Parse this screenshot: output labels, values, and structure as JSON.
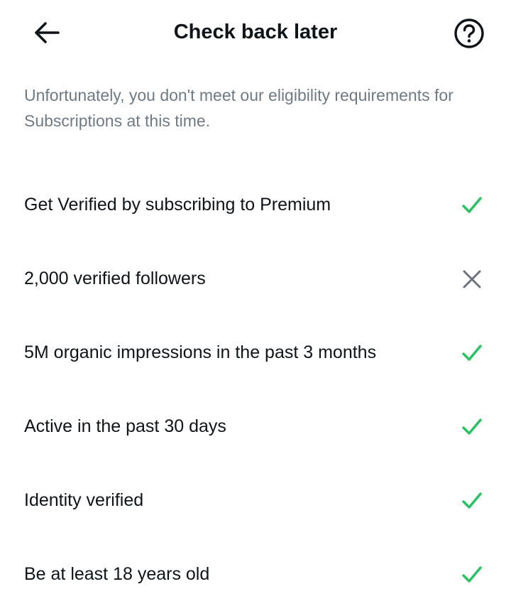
{
  "header": {
    "title": "Check back later",
    "back_icon": "arrow-left-icon",
    "help_icon": "question-circle-icon"
  },
  "description": "Unfortunately, you don't meet our eligibility requirements for Subscriptions at this time.",
  "colors": {
    "met": "#22c55e",
    "unmet": "#6b7280",
    "text": "#0f1419",
    "muted": "#6e7a85"
  },
  "requirements": [
    {
      "label": "Get Verified by subscribing to Premium",
      "met": true
    },
    {
      "label": "2,000 verified followers",
      "met": false
    },
    {
      "label": "5M organic impressions in the past 3 months",
      "met": true
    },
    {
      "label": "Active in the past 30 days",
      "met": true
    },
    {
      "label": "Identity verified",
      "met": true
    },
    {
      "label": "Be at least 18 years old",
      "met": true
    }
  ]
}
